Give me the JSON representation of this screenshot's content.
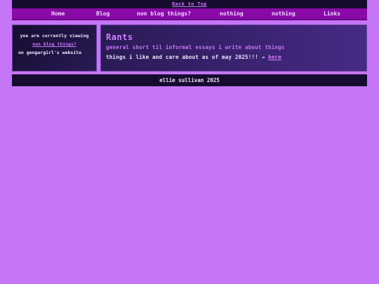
{
  "top": {
    "back_to_top": "Back to Top"
  },
  "nav": {
    "items": [
      {
        "label": "Home"
      },
      {
        "label": "Blog"
      },
      {
        "label": "non blog things?"
      },
      {
        "label": "nothing"
      },
      {
        "label": "nothing"
      },
      {
        "label": "Links"
      }
    ]
  },
  "sidebar": {
    "line1": "you are currently viewing",
    "link": "non blog things?",
    "line3": "on gengargirl's website"
  },
  "main": {
    "title": "Rants",
    "subtitle": "general short til informal essays i write about things",
    "body_text": "things i like and care about as of may 2025!!! → ",
    "body_link": "here"
  },
  "footer": {
    "text": "ellie sullivan 2025"
  },
  "colors": {
    "background": "#c576f6",
    "dark": "#160c30",
    "nav": "#8a0aa8",
    "accent": "#d47fff"
  }
}
